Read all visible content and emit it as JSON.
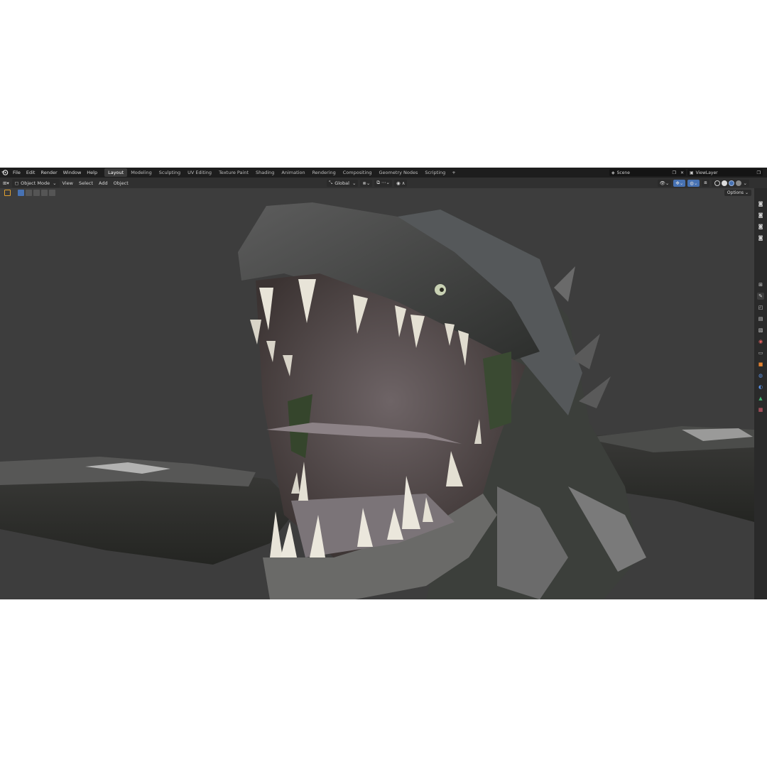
{
  "topbar": {
    "menus": [
      "File",
      "Edit",
      "Render",
      "Window",
      "Help"
    ],
    "workspace_tabs": [
      "Layout",
      "Modeling",
      "Sculpting",
      "UV Editing",
      "Texture Paint",
      "Shading",
      "Animation",
      "Rendering",
      "Compositing",
      "Geometry Nodes",
      "Scripting"
    ],
    "active_tab": "Layout",
    "scene_name": "Scene",
    "view_layer": "ViewLayer"
  },
  "header": {
    "mode": "Object Mode",
    "menus": [
      "View",
      "Select",
      "Add",
      "Object"
    ],
    "transform_orientation": "Global",
    "options_label": "Options"
  },
  "colors": {
    "accent": "#4772b3",
    "background": "#3d3d3d",
    "topbar": "#1d1d1d"
  },
  "icons": [
    "blender-logo-icon",
    "editor-type-icon",
    "object-mode-icon",
    "orientation-icon",
    "snap-icon",
    "proportional-edit-icon",
    "visibility-icon",
    "gizmo-icon",
    "overlay-icon",
    "xray-icon",
    "solid-shading-icon",
    "material-preview-icon",
    "rendered-icon",
    "tool-icon",
    "render-properties-icon",
    "output-icon",
    "view-layer-icon",
    "scene-icon",
    "world-icon",
    "object-icon",
    "modifier-icon",
    "particles-icon",
    "physics-icon",
    "constraints-icon",
    "data-icon",
    "material-icon",
    "texture-icon"
  ]
}
